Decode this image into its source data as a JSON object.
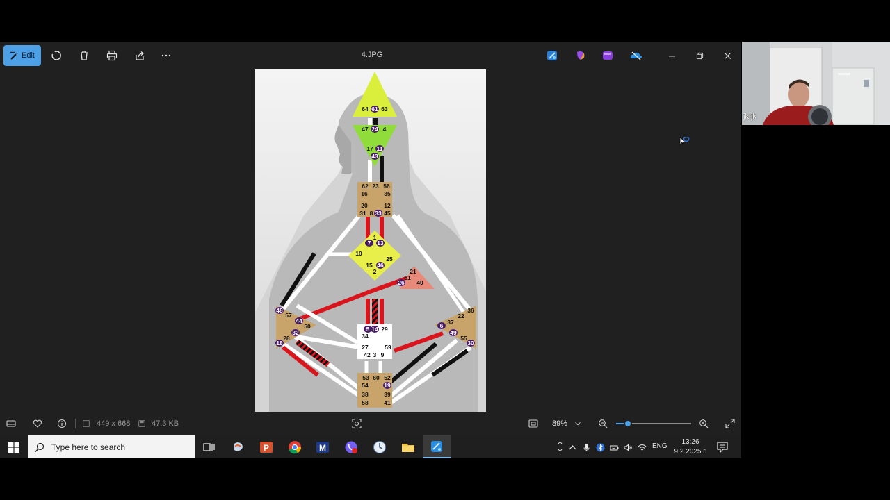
{
  "viewer": {
    "file_name": "4.JPG",
    "edit_label": "Edit",
    "toolbar_icons": [
      "rotate-icon",
      "delete-icon",
      "print-icon",
      "share-icon",
      "more-icon"
    ],
    "app_icons": [
      "clipchamp-icon",
      "copilot-icon",
      "clipchamp-video-icon",
      "onedrive-icon"
    ]
  },
  "bottombar": {
    "dimensions": "449 x 668",
    "file_size": "47.3 KB",
    "zoom": "89%",
    "zoom_fraction": 0.16
  },
  "bodygraph": {
    "head": [
      "64",
      "61",
      "63"
    ],
    "ajna": [
      "47",
      "24",
      "4",
      "17",
      "11",
      "43"
    ],
    "throat": [
      "62",
      "23",
      "56",
      "16",
      "35",
      "20",
      "12",
      "31",
      "8",
      "33",
      "45"
    ],
    "g_center": [
      "1",
      "7",
      "13",
      "10",
      "25",
      "15",
      "46",
      "2"
    ],
    "ego": [
      "21",
      "51",
      "26",
      "40"
    ],
    "spleen": [
      "48",
      "57",
      "44",
      "50",
      "32",
      "28",
      "18"
    ],
    "solar_plexus": [
      "36",
      "22",
      "6",
      "37",
      "49",
      "55",
      "30"
    ],
    "sacral": [
      "5",
      "14",
      "29",
      "34",
      "27",
      "59",
      "42",
      "3",
      "9"
    ],
    "root": [
      "53",
      "60",
      "52",
      "54",
      "19",
      "38",
      "39",
      "58",
      "41"
    ]
  },
  "webcam": {
    "name": "jk jk"
  },
  "taskbar": {
    "search_placeholder": "Type here to search",
    "language": "ENG",
    "time": "13:26",
    "date": "9.2.2025 г."
  },
  "colors": {
    "accent": "#4ea0e6",
    "head_center": "#d9ef3c",
    "ajna_center": "#8fdc3a",
    "throat_center": "#c9a46a",
    "g_center": "#e8ef4a",
    "ego_center": "#e88a7a",
    "channel_red": "#d8151d",
    "channel_black": "#111111"
  }
}
